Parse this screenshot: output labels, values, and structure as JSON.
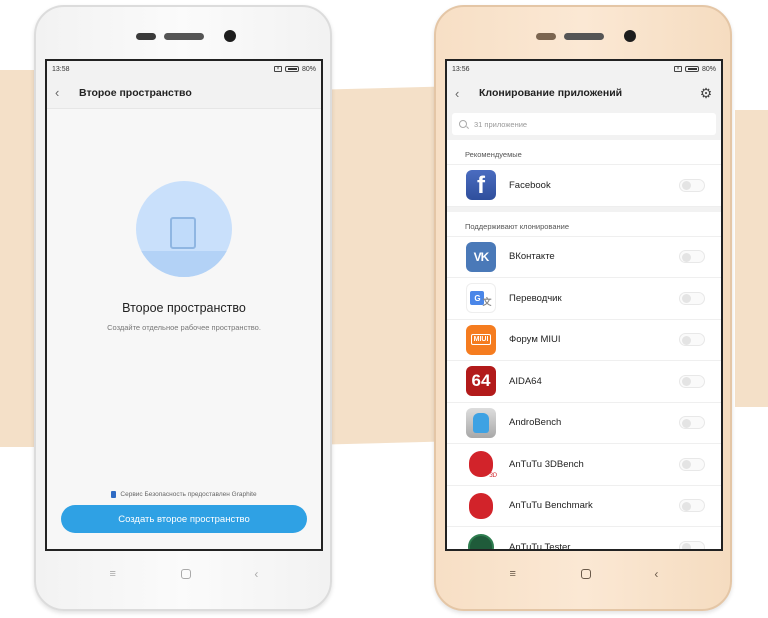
{
  "colors": {
    "background_band": "#f4e0c8",
    "primary_button": "#2fa1e4",
    "phone_gold": "#f9e3cc",
    "phone_white": "#f7f7f7"
  },
  "left_phone": {
    "status": {
      "time": "13:58",
      "battery": "80%"
    },
    "title": "Второе пространство",
    "illustration_icon": "tablet-icon",
    "heading": "Второе пространство",
    "subtitle": "Создайте отдельное рабочее пространство.",
    "service_note": "Сервис Безопасность предоставлен Graphite",
    "create_button": "Создать второе пространство",
    "nav": {
      "menu": "≡",
      "home": "",
      "back": "‹"
    }
  },
  "right_phone": {
    "status": {
      "time": "13:56",
      "battery": "80%"
    },
    "title": "Клонирование приложений",
    "search_placeholder": "31 приложение",
    "sections": [
      {
        "label": "Рекомендуемые",
        "apps": [
          {
            "name": "Facebook",
            "icon": "facebook-icon",
            "glyph": "f",
            "enabled": false
          }
        ]
      },
      {
        "label": "Поддерживают клонирование",
        "apps": [
          {
            "name": "ВКонтакте",
            "icon": "vk-icon",
            "glyph": "VK",
            "enabled": false
          },
          {
            "name": "Переводчик",
            "icon": "google-translate-icon",
            "glyph": "G",
            "enabled": false
          },
          {
            "name": "Форум MIUI",
            "icon": "miui-forum-icon",
            "glyph": "MIUI",
            "enabled": false
          },
          {
            "name": "AIDA64",
            "icon": "aida64-icon",
            "glyph": "64",
            "enabled": false
          },
          {
            "name": "AndroBench",
            "icon": "androbench-icon",
            "glyph": "",
            "enabled": false
          },
          {
            "name": "AnTuTu 3DBench",
            "icon": "antutu-3dbench-icon",
            "glyph": "3D",
            "enabled": false
          },
          {
            "name": "AnTuTu Benchmark",
            "icon": "antutu-benchmark-icon",
            "glyph": "",
            "enabled": false
          },
          {
            "name": "AnTuTu Tester",
            "icon": "antutu-tester-icon",
            "glyph": "",
            "enabled": false
          }
        ]
      }
    ],
    "nav": {
      "menu": "≡",
      "home": "",
      "back": "‹"
    }
  }
}
